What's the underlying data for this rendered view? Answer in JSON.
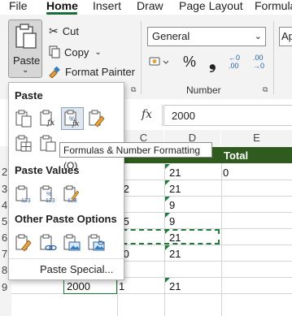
{
  "menu": {
    "tabs": [
      "File",
      "Home",
      "Insert",
      "Draw",
      "Page Layout",
      "Formula"
    ],
    "active": "Home"
  },
  "ribbon": {
    "paste_label": "Paste",
    "cut_label": "Cut",
    "copy_label": "Copy",
    "format_painter_label": "Format Painter",
    "number_format_value": "General",
    "number_group_label": "Number",
    "partial_combo_text": "Ap",
    "percent_symbol": "%",
    "comma_symbol": "❟",
    "increase_decimal_top": "←0",
    "increase_decimal_bottom": ".00",
    "decrease_decimal_top": ".00",
    "decrease_decimal_bottom": "→0"
  },
  "formula_bar": {
    "fx": "fx",
    "value": "2000"
  },
  "sheet": {
    "columns": [
      "C",
      "D",
      "E"
    ],
    "header_total": "Total",
    "row_numbers": [
      "2",
      "3",
      "4",
      "5",
      "6",
      "7",
      "8",
      "9"
    ],
    "cells": {
      "e2": "0",
      "c3_partial": ".2",
      "c5_partial": ".5",
      "c7_partial": ".0",
      "d2": "21",
      "d3": "21",
      "d4": "9",
      "d5": "9",
      "d6": "21",
      "d7": "21",
      "d9": "21",
      "b9": "2000",
      "c9": "1"
    }
  },
  "paste_menu": {
    "section_paste": "Paste",
    "section_values": "Paste Values",
    "section_other": "Other Paste Options",
    "paste_special": "Paste Special...",
    "tooltip": "Formulas & Number Formatting (O)"
  },
  "colors": {
    "accent_green": "#1f5c2e",
    "header_green": "#375623",
    "selection_green": "#1e7a3b"
  }
}
